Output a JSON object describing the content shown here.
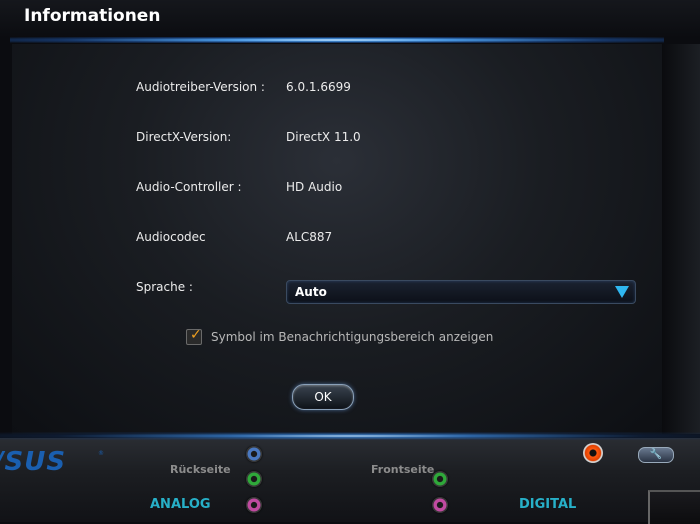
{
  "window": {
    "title": "Informationen"
  },
  "info": {
    "driver_label": "Audiotreiber-Version :",
    "driver_value": "6.0.1.6699",
    "directx_label": "DirectX-Version:",
    "directx_value": "DirectX 11.0",
    "controller_label": "Audio-Controller :",
    "controller_value": "HD Audio",
    "codec_label": "Audiocodec",
    "codec_value": "ALC887"
  },
  "language": {
    "label": "Sprache :",
    "value": "Auto"
  },
  "tray_option": {
    "label": "Symbol im Benachrichtigungsbereich anzeigen",
    "checked": true
  },
  "buttons": {
    "ok_label": "OK"
  },
  "bottom": {
    "logo": "/SUS",
    "rear_label": "Rückseite",
    "front_label": "Frontseite",
    "analog_label": "ANALOG",
    "digital_label": "DIGITAL",
    "jack_colors": {
      "blue": "#4a78c0",
      "green": "#2fa83a",
      "pink": "#c04aa0"
    }
  }
}
